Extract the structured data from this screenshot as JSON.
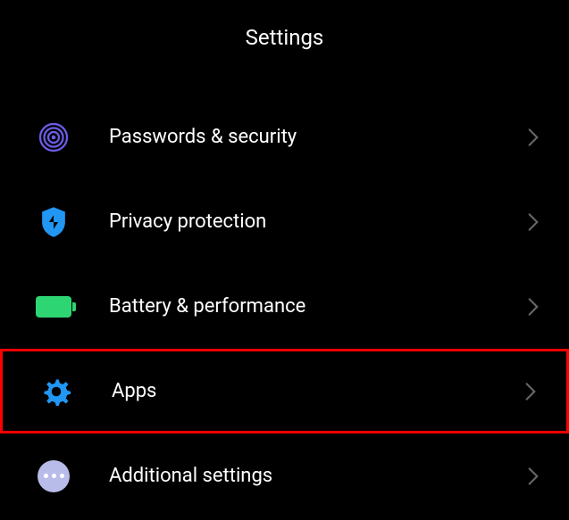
{
  "header": {
    "title": "Settings"
  },
  "items": [
    {
      "label": "Passwords & security",
      "icon": "fingerprint",
      "iconColor": "#6c5ce7",
      "highlighted": false
    },
    {
      "label": "Privacy protection",
      "icon": "shield",
      "iconColor": "#2196f3",
      "highlighted": false
    },
    {
      "label": "Battery & performance",
      "icon": "battery",
      "iconColor": "#2ed573",
      "highlighted": false
    },
    {
      "label": "Apps",
      "icon": "gear",
      "iconColor": "#2196f3",
      "highlighted": true
    },
    {
      "label": "Additional settings",
      "icon": "dots",
      "iconColor": "#b8bce8",
      "highlighted": false
    }
  ]
}
